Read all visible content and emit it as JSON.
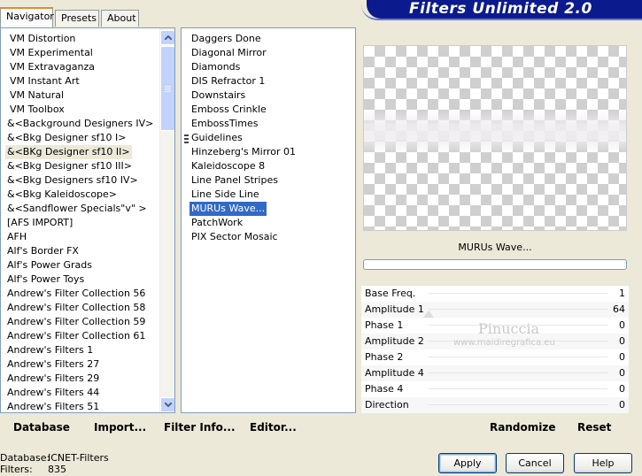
{
  "tabs": [
    "Navigator",
    "Presets",
    "About"
  ],
  "banner_title": "Filters Unlimited 2.0",
  "categories": [
    "VM Distortion",
    "VM Experimental",
    "VM Extravaganza",
    "VM Instant Art",
    "VM Natural",
    "VM Toolbox",
    "&<Background Designers IV>",
    "&<Bkg Designer sf10 I>",
    "&<BKg Designer sf10 II>",
    "&<Bkg Designer sf10 III>",
    "&<Bkg Designers sf10 IV>",
    "&<Bkg Kaleidoscope>",
    "&<Sandflower Specials\"v\" >",
    "[AFS IMPORT]",
    "AFH",
    "Alf's Border FX",
    "Alf's Power Grads",
    "Alf's Power Toys",
    "Andrew's Filter Collection 56",
    "Andrew's Filter Collection 58",
    "Andrew's Filter Collection 59",
    "Andrew's Filter Collection 61",
    "Andrew's Filters 1",
    "Andrew's Filters 27",
    "Andrew's Filters 29",
    "Andrew's Filters 44",
    "Andrew's Filters 51"
  ],
  "filters": [
    "Daggers Done",
    "Diagonal Mirror",
    "Diamonds",
    "DIS Refractor 1",
    "Downstairs",
    "Emboss Crinkle",
    "EmbossTimes",
    "Guidelines",
    "Hinzeberg's Mirror 01",
    "Kaleidoscope 8",
    "Line Panel Stripes",
    "Line Side Line",
    "MURUs Wave...",
    "PatchWork",
    "PIX Sector Mosaic"
  ],
  "selected_filter_name": "MURUs Wave...",
  "parameters": [
    {
      "name": "Base Freq.",
      "value": "1"
    },
    {
      "name": "Amplitude 1",
      "value": "64"
    },
    {
      "name": "Phase 1",
      "value": "0"
    },
    {
      "name": "Amplitude 2",
      "value": "0"
    },
    {
      "name": "Phase 2",
      "value": "0"
    },
    {
      "name": "Amplitude 4",
      "value": "0"
    },
    {
      "name": "Phase 4",
      "value": "0"
    },
    {
      "name": "Direction",
      "value": "0"
    }
  ],
  "watermark": {
    "name": "Pinuccia",
    "site": "www.maidiregrafica.eu"
  },
  "bottom_links": {
    "database": "Database",
    "import": "Import...",
    "filter_info": "Filter Info...",
    "editor": "Editor...",
    "randomize": "Randomize",
    "reset": "Reset"
  },
  "buttons": {
    "apply": "Apply",
    "cancel": "Cancel",
    "help": "Help"
  },
  "status": {
    "database_label": "Database:",
    "database_value": "ICNET-Filters",
    "filters_label": "Filters:",
    "filters_value": "835"
  }
}
